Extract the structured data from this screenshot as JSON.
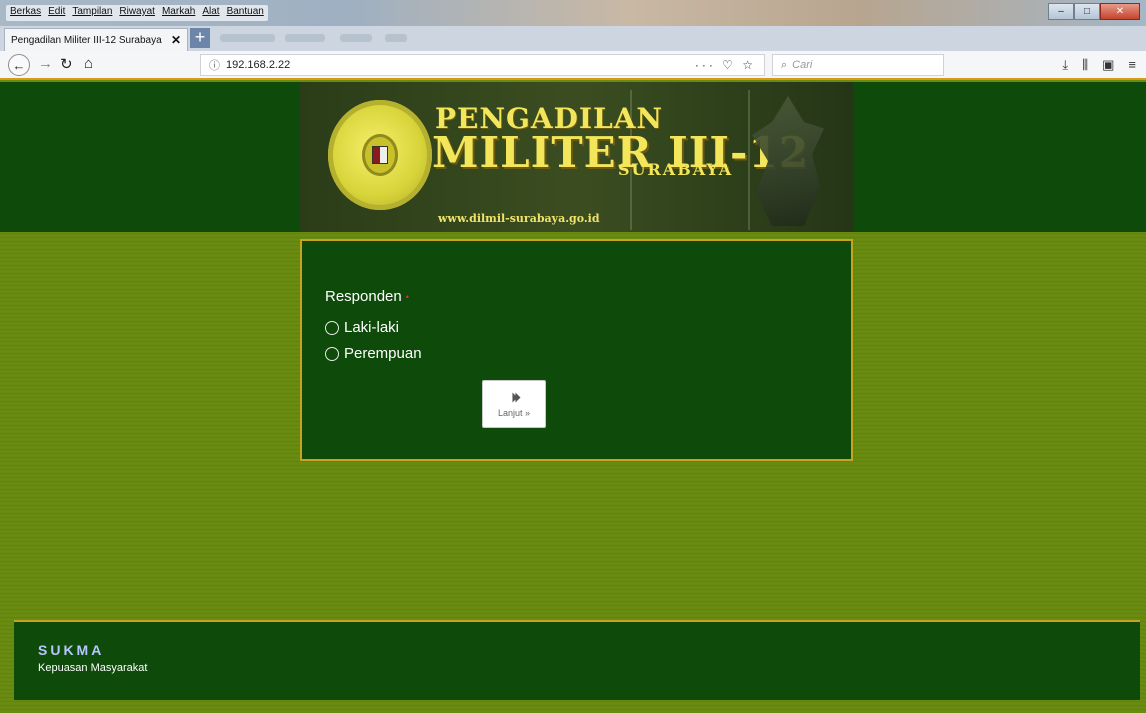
{
  "browser": {
    "menu": [
      "Berkas",
      "Edit",
      "Tampilan",
      "Riwayat",
      "Markah",
      "Alat",
      "Bantuan"
    ],
    "tab_title": "Pengadilan Militer III-12 Surabaya",
    "tab_close": "✕",
    "new_tab": "+",
    "url": "192.168.2.22",
    "url_info_icon": "ⓘ",
    "url_actions": "··· ♡ ☆",
    "search_placeholder": "Cari",
    "window_buttons": [
      "–",
      "□",
      "✕"
    ]
  },
  "banner": {
    "title_line1": "PENGADILAN",
    "title_line2": "MILITER III-12",
    "title_line3": "SURABAYA",
    "website": "www.dilmil-surabaya.go.id"
  },
  "form": {
    "question": "Responden",
    "required_mark": "•",
    "options": [
      "Laki-laki",
      "Perempuan"
    ],
    "next_icon": "⏵⏵",
    "next_label": "Lanjut »"
  },
  "footer": {
    "title": "SUKMA",
    "subtitle": "Kepuasan Masyarakat"
  },
  "colors": {
    "header_green": "#0e4a0a",
    "page_green": "#6a8b12",
    "accent_gold": "#c9a21f",
    "banner_text": "#f3e65a"
  }
}
